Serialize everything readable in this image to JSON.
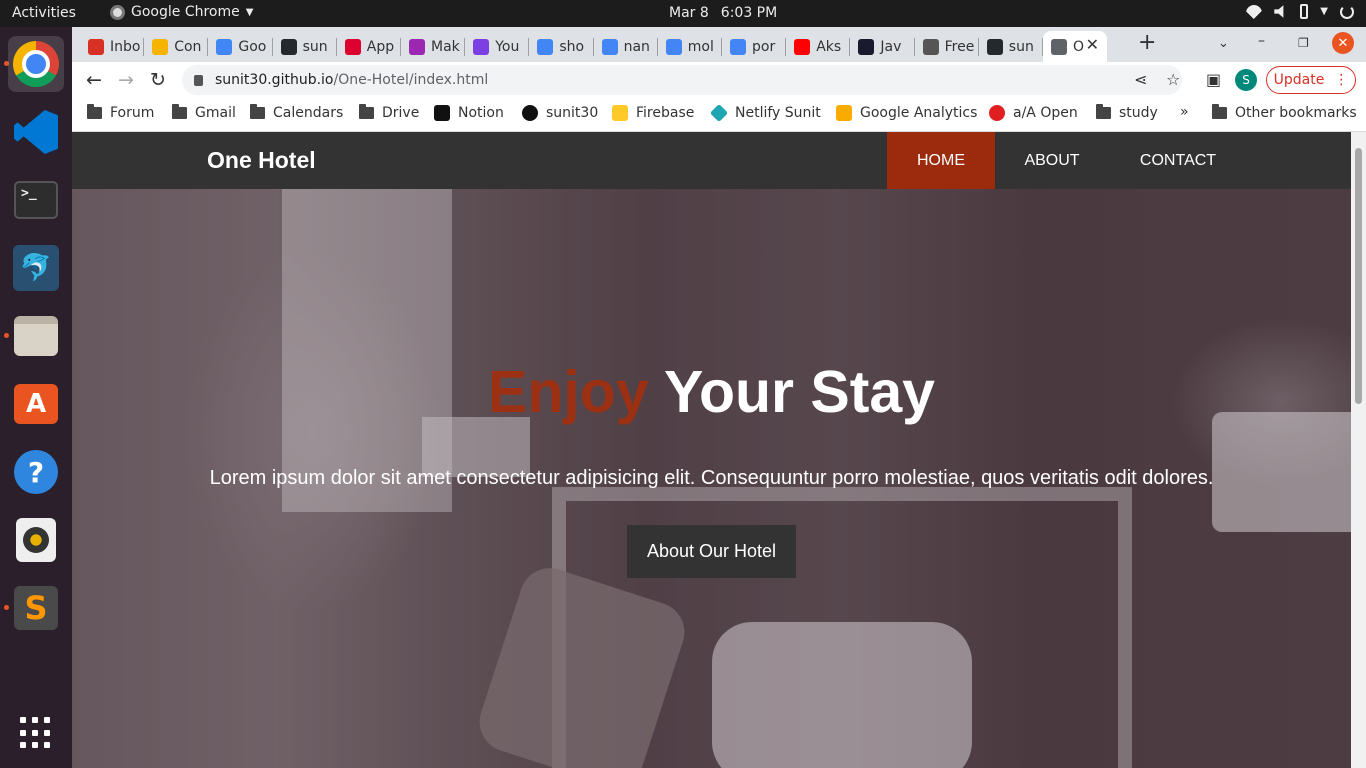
{
  "topbar": {
    "activities": "Activities",
    "app_name": "Google Chrome",
    "date": "Mar 8",
    "time": "6:03 PM"
  },
  "dock": {
    "apps": [
      "Google Chrome",
      "Visual Studio Code",
      "Terminal",
      "MySQL Workbench",
      "Files",
      "Ubuntu Software",
      "Help",
      "Rhythmbox",
      "Sublime Text",
      "Show Applications"
    ]
  },
  "tabs": [
    {
      "title": "Inbo",
      "icon_color": "#d93025"
    },
    {
      "title": "Con",
      "icon_color": "#f4b400"
    },
    {
      "title": "Goo",
      "icon_color": "#4285f4"
    },
    {
      "title": "sun",
      "icon_color": "#24292e"
    },
    {
      "title": "App",
      "icon_color": "#dd0031"
    },
    {
      "title": "Mak",
      "icon_color": "#9c27b0"
    },
    {
      "title": "You",
      "icon_color": "#7b3fe4"
    },
    {
      "title": "sho",
      "icon_color": "#4285f4"
    },
    {
      "title": "nan",
      "icon_color": "#4285f4"
    },
    {
      "title": "mol",
      "icon_color": "#4285f4"
    },
    {
      "title": "por",
      "icon_color": "#4285f4"
    },
    {
      "title": "Aks",
      "icon_color": "#ff0000"
    },
    {
      "title": "Jav",
      "icon_color": "#1a1a2e"
    },
    {
      "title": "Free",
      "icon_color": "#555555"
    },
    {
      "title": "sun",
      "icon_color": "#24292e"
    },
    {
      "title": "O",
      "icon_color": "#5f6368"
    }
  ],
  "omnibox": {
    "host": "sunit30.github.io",
    "path": "/One-Hotel/index.html"
  },
  "profile_initial": "S",
  "update_label": "Update",
  "bookmarks": [
    {
      "label": "Forum",
      "icon": "folder"
    },
    {
      "label": "Gmail",
      "icon": "folder"
    },
    {
      "label": "Calendars",
      "icon": "folder"
    },
    {
      "label": "Drive",
      "icon": "folder"
    },
    {
      "label": "Notion",
      "icon": "notion-icon"
    },
    {
      "label": "sunit30",
      "icon": "github-icon"
    },
    {
      "label": "Firebase",
      "icon": "firebase-icon"
    },
    {
      "label": "Netlify Sunit",
      "icon": "netlify-icon"
    },
    {
      "label": "Google Analytics",
      "icon": "analytics-icon"
    },
    {
      "label": "a/A Open",
      "icon": "appacademy-icon"
    },
    {
      "label": "study",
      "icon": "folder"
    }
  ],
  "bookmarks_more": "»",
  "other_bookmarks": "Other bookmarks",
  "site": {
    "brand": "One Hotel",
    "nav": [
      "HOME",
      "ABOUT",
      "CONTACT"
    ],
    "active_nav": "HOME",
    "accent_color": "#9c2a0d",
    "hero": {
      "title_accent": "Enjoy",
      "title_rest": "Your Stay",
      "text": "Lorem ipsum dolor sit amet consectetur adipisicing elit. Consequuntur porro molestiae, quos veritatis odit dolores.",
      "button": "About Our Hotel"
    }
  }
}
